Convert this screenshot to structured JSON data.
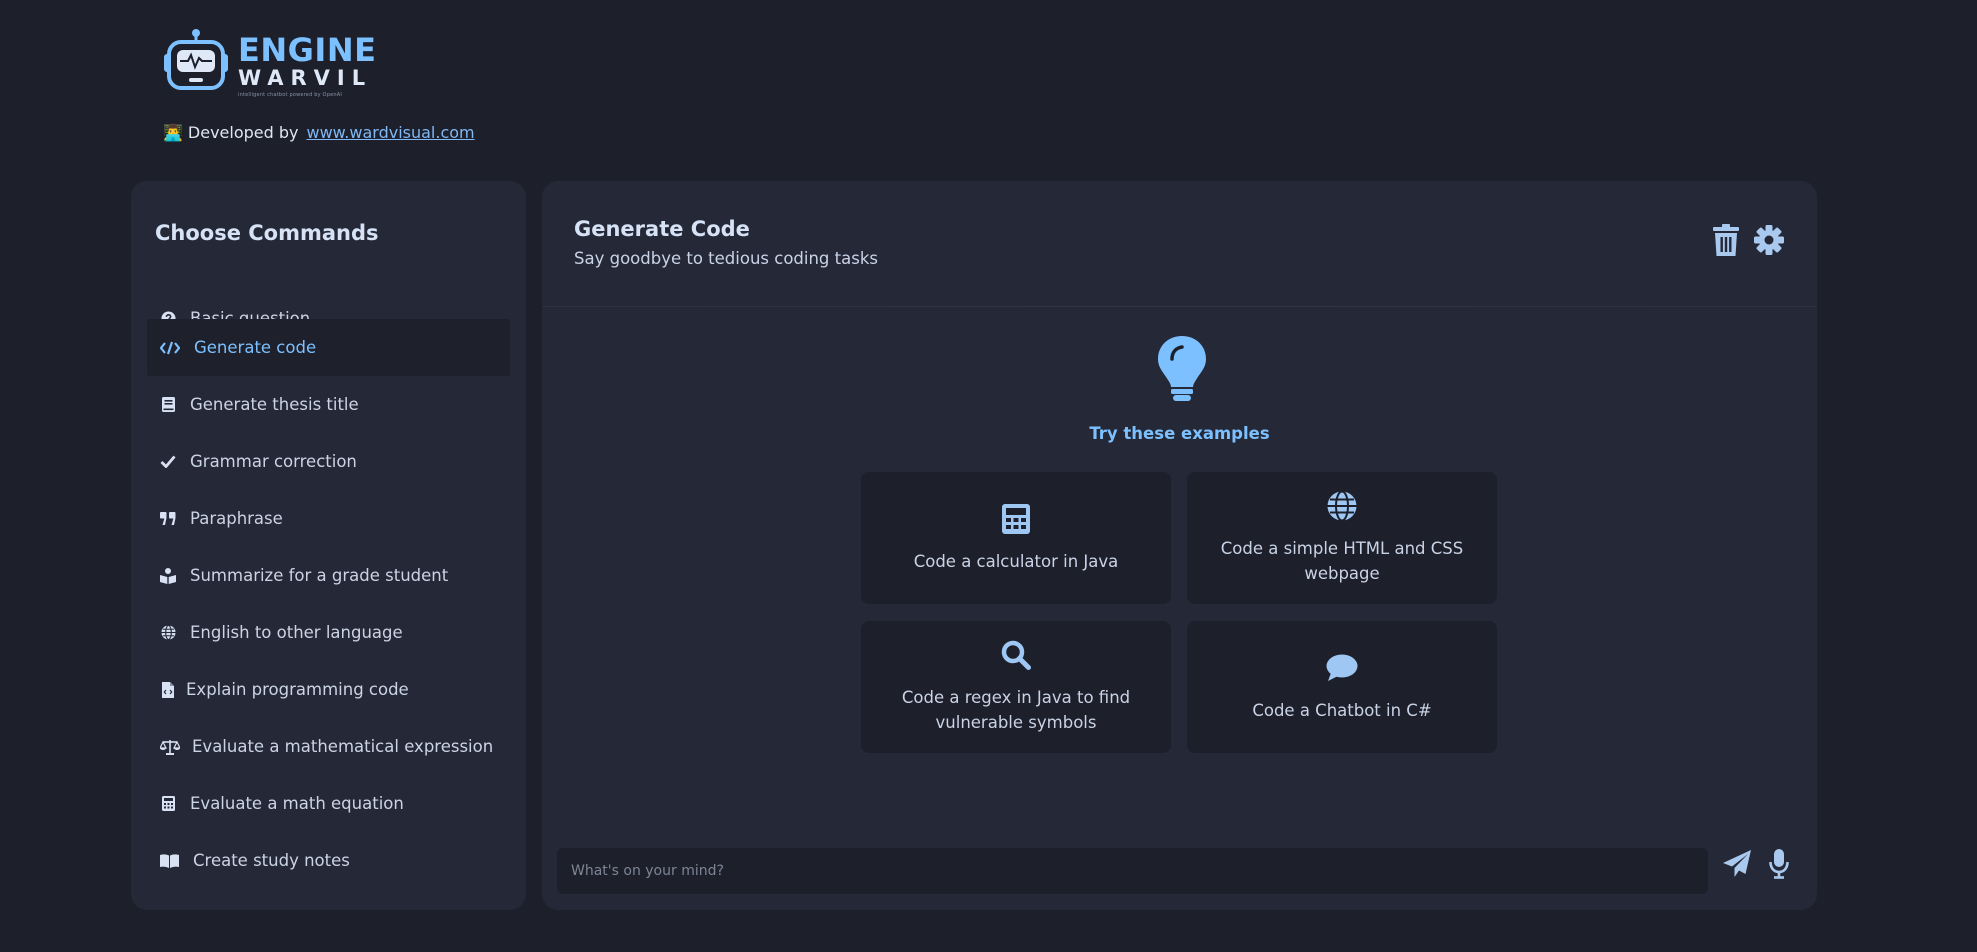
{
  "brand": {
    "name_line1": "ENGINE",
    "name_line2": "WARVIL",
    "tagline": "intelligent chatbot powered by OpenAI",
    "accent_color": "#7cc0ff"
  },
  "developer": {
    "emoji": "👨‍💻",
    "label": "Developed by",
    "link_text": "www.wardvisual.com"
  },
  "sidebar": {
    "title": "Choose Commands",
    "items": [
      {
        "label": "Basic question",
        "icon": "question-circle-icon"
      },
      {
        "label": "Generate code",
        "icon": "code-icon",
        "active": true
      },
      {
        "label": "Generate thesis title",
        "icon": "book-icon"
      },
      {
        "label": "Grammar correction",
        "icon": "check-icon"
      },
      {
        "label": "Paraphrase",
        "icon": "quote-icon"
      },
      {
        "label": "Summarize for a grade student",
        "icon": "book-reader-icon"
      },
      {
        "label": "English to other language",
        "icon": "globe-icon"
      },
      {
        "label": "Explain programming code",
        "icon": "file-code-icon"
      },
      {
        "label": "Evaluate a mathematical expression",
        "icon": "balance-scale-icon"
      },
      {
        "label": "Evaluate a math equation",
        "icon": "calculator-icon"
      },
      {
        "label": "Create study notes",
        "icon": "open-book-icon"
      }
    ]
  },
  "main": {
    "title": "Generate Code",
    "subtitle": "Say goodbye to tedious coding tasks",
    "tools": [
      "trash-icon",
      "gear-icon"
    ],
    "examples_heading": "Try these examples",
    "examples_icon": "lightbulb-icon",
    "examples": [
      {
        "label": "Code a calculator in Java",
        "icon": "calculator-icon"
      },
      {
        "label": "Code a simple HTML and CSS webpage",
        "icon": "globe-icon"
      },
      {
        "label": "Code a regex in Java to find vulnerable symbols",
        "icon": "search-icon"
      },
      {
        "label": "Code a Chatbot in C#",
        "icon": "comment-icon"
      }
    ],
    "input_placeholder": "What's on your mind?",
    "send_icon": "paper-plane-icon",
    "mic_icon": "microphone-icon"
  }
}
